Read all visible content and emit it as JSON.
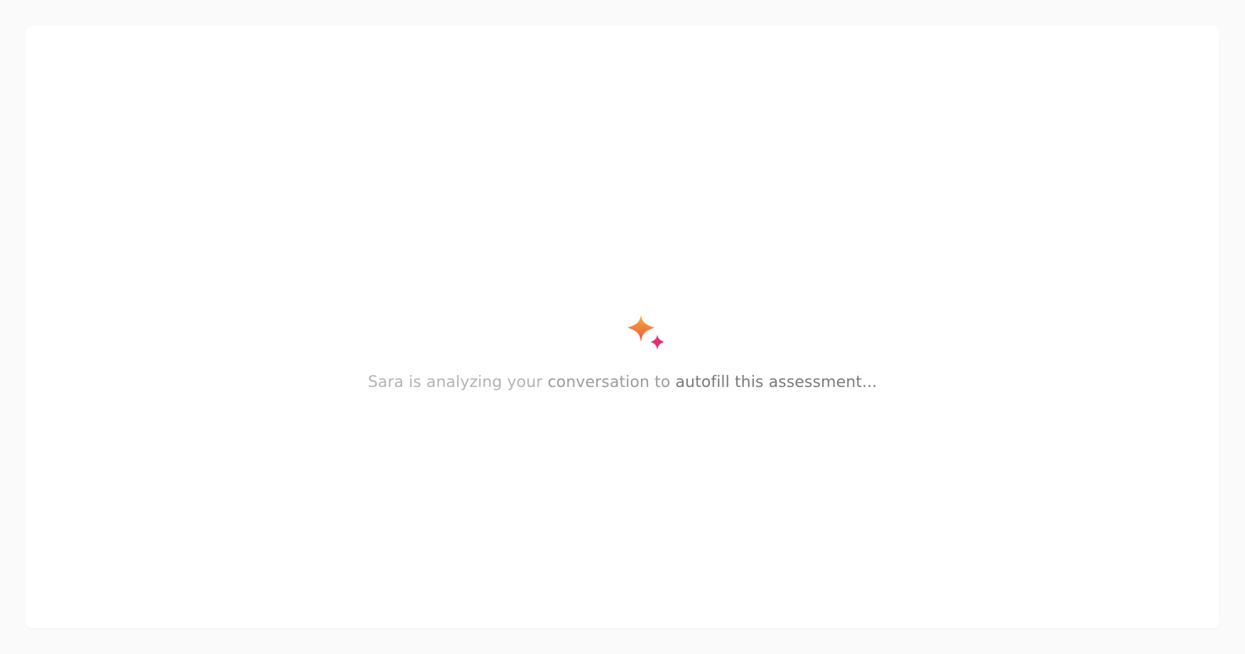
{
  "loader": {
    "icon": "sparkle-icon",
    "message_part1": "Sara is analyzing your",
    "message_part2": "conversation to",
    "message_part3": "autofill this assessment..."
  },
  "colors": {
    "page_background": "#fafafa",
    "card_background": "#ffffff",
    "sparkle_large_top": "#f4a43a",
    "sparkle_large_bottom": "#ef5a3c",
    "sparkle_small": "#e52d72",
    "text_faded": "#b3b3b3",
    "text_dark": "#7a7a7a"
  }
}
